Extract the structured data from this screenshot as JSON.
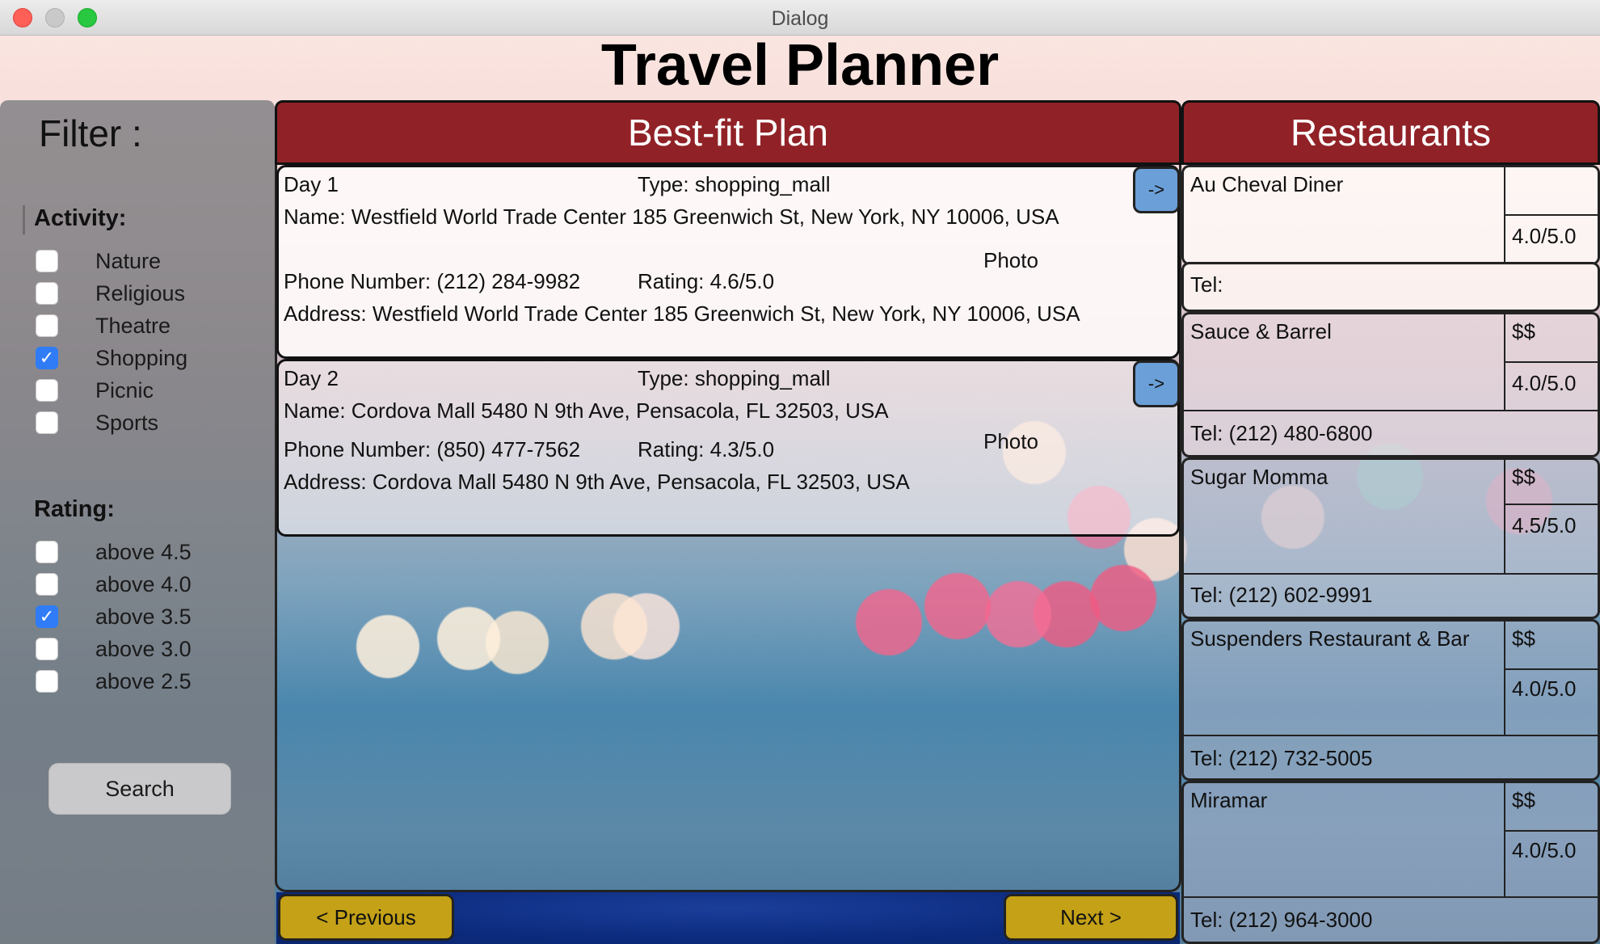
{
  "window": {
    "title": "Dialog"
  },
  "app": {
    "title": "Travel Planner"
  },
  "filter": {
    "heading": "Filter  :",
    "activity_heading": "Activity:",
    "activities": [
      {
        "label": "Nature",
        "checked": false
      },
      {
        "label": "Religious",
        "checked": false
      },
      {
        "label": "Theatre",
        "checked": false
      },
      {
        "label": "Shopping",
        "checked": true
      },
      {
        "label": "Picnic",
        "checked": false
      },
      {
        "label": "Sports",
        "checked": false
      }
    ],
    "rating_heading": "Rating:",
    "ratings": [
      {
        "label": "above 4.5",
        "checked": false
      },
      {
        "label": "above 4.0",
        "checked": false
      },
      {
        "label": "above 3.5",
        "checked": true
      },
      {
        "label": "above 3.0",
        "checked": false
      },
      {
        "label": "above 2.5",
        "checked": false
      }
    ],
    "search_label": "Search"
  },
  "plan": {
    "heading": "Best-fit Plan",
    "days": [
      {
        "day": "Day 1",
        "type": "Type: shopping_mall",
        "name": "Name: Westfield World Trade Center 185 Greenwich St, New York, NY 10006, USA",
        "photo": "Photo",
        "phone": "Phone Number: (212) 284-9982",
        "rating": "Rating: 4.6/5.0",
        "address": "Address: Westfield World Trade Center 185 Greenwich St, New York, NY 10006, USA",
        "arrow": "->"
      },
      {
        "day": "Day 2",
        "type": "Type: shopping_mall",
        "name": "Name: Cordova Mall 5480 N 9th Ave, Pensacola, FL 32503, USA",
        "photo": "Photo",
        "phone": "Phone Number: (850) 477-7562",
        "rating": "Rating: 4.3/5.0",
        "address": "Address: Cordova Mall 5480 N 9th Ave, Pensacola, FL 32503, USA",
        "arrow": "->"
      }
    ],
    "prev_label": "< Previous",
    "next_label": "Next >"
  },
  "restaurants": {
    "heading": "Restaurants",
    "items": [
      {
        "name": "Au Cheval Diner",
        "price": "",
        "rating": "4.0/5.0",
        "tel": "Tel:"
      },
      {
        "name": "Sauce & Barrel",
        "price": "$$",
        "rating": "4.0/5.0",
        "tel": "Tel: (212) 480-6800"
      },
      {
        "name": "Sugar Momma",
        "price": "$$",
        "rating": "4.5/5.0",
        "tel": "Tel: (212) 602-9991"
      },
      {
        "name": "Suspenders Restaurant & Bar",
        "price": "$$",
        "rating": "4.0/5.0",
        "tel": "Tel: (212) 732-5005"
      },
      {
        "name": "Miramar",
        "price": "$$",
        "rating": "4.0/5.0",
        "tel": "Tel: (212) 964-3000"
      }
    ]
  },
  "colors": {
    "header_red": "#902227",
    "nav_gold": "#c4a117",
    "arrow_blue": "#6b9fd8",
    "checkbox_blue": "#2f7cf6"
  }
}
